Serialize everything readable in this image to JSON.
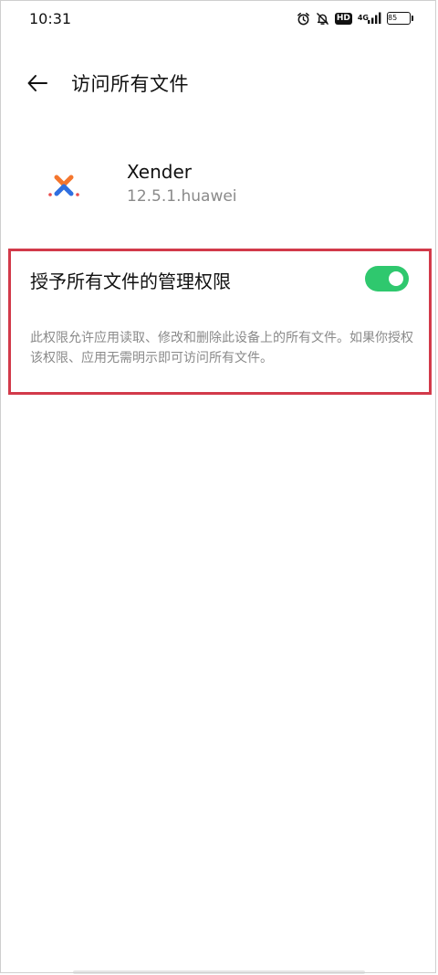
{
  "status_bar": {
    "time": "10:31",
    "network": "4G",
    "hd": "HD",
    "battery": "85"
  },
  "header": {
    "title": "访问所有文件"
  },
  "app": {
    "name": "Xender",
    "version": "12.5.1.huawei"
  },
  "permission": {
    "label": "授予所有文件的管理权限",
    "enabled": true,
    "description": "此权限允许应用读取、修改和删除此设备上的所有文件。如果你授权该权限、应用无需明示即可访问所有文件。"
  },
  "colors": {
    "toggle_on": "#2fc86e",
    "highlight": "#d23a4a",
    "secondary_text": "#8a8a8a"
  }
}
